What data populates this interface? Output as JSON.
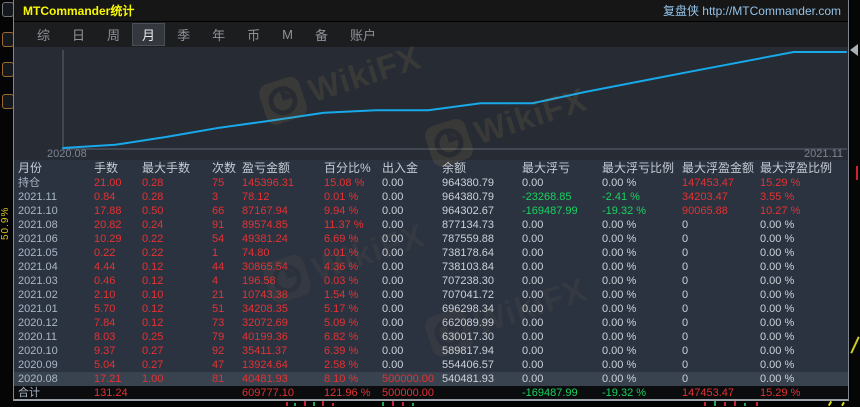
{
  "window": {
    "title": "MTCommander统计",
    "brand": "复盘侠 http://MTCommander.com"
  },
  "background": {
    "left_percent": "50.9%"
  },
  "menu": {
    "items": [
      {
        "label": "综",
        "selected": false
      },
      {
        "label": "日",
        "selected": false
      },
      {
        "label": "周",
        "selected": false
      },
      {
        "label": "月",
        "selected": true
      },
      {
        "label": "季",
        "selected": false
      },
      {
        "label": "年",
        "selected": false
      },
      {
        "label": "币",
        "selected": false
      },
      {
        "label": "M",
        "selected": false
      },
      {
        "label": "备",
        "selected": false
      },
      {
        "label": "账户",
        "selected": false
      }
    ]
  },
  "chart": {
    "x_start_label": "2020.08",
    "x_end_label": "2021.11",
    "watermark_text": "WikiFX"
  },
  "chart_data": {
    "type": "line",
    "title": "",
    "x": [
      "2020.08",
      "2020.09",
      "2020.10",
      "2020.11",
      "2020.12",
      "2021.01",
      "2021.02",
      "2021.03",
      "2021.04",
      "2021.05",
      "2021.06",
      "2021.08",
      "2021.10",
      "2021.11"
    ],
    "series": [
      {
        "name": "余额",
        "values": [
          540481.93,
          554406.57,
          589817.94,
          630017.3,
          662089.99,
          696298.34,
          707041.72,
          707238.3,
          738103.84,
          738178.64,
          787559.88,
          877134.73,
          964302.67,
          964380.79
        ]
      }
    ],
    "xlabel": "",
    "ylabel": "",
    "visible_tick_labels": [
      "2020.08",
      "2021.11"
    ],
    "line_color": "#17a9ea",
    "grid": false,
    "legend": false
  },
  "table": {
    "headers": [
      "月份",
      "手数",
      "最大手数",
      "次数",
      "盈亏金额",
      "百分比%",
      "出入金",
      "余额",
      "最大浮亏",
      "最大浮亏比例",
      "最大浮盈金额",
      "最大浮盈比例"
    ],
    "rows": [
      {
        "cells": [
          "持仓",
          "21.00",
          "0.28",
          "75",
          "145396.31",
          "15.08 %",
          "0.00",
          "964380.79",
          "0.00",
          "0.00 %",
          "147453.47",
          "15.29 %"
        ],
        "colors": [
          "m",
          "r",
          "r",
          "r",
          "r",
          "r",
          "w",
          "w",
          "w",
          "w",
          "r",
          "r"
        ]
      },
      {
        "cells": [
          "2021.11",
          "0.84",
          "0.28",
          "3",
          "78.12",
          "0.01 %",
          "0.00",
          "964380.79",
          "-23268.85",
          "-2.41 %",
          "34203.47",
          "3.55 %"
        ],
        "colors": [
          "m",
          "r",
          "r",
          "r",
          "r",
          "r",
          "w",
          "w",
          "g",
          "g",
          "r",
          "r"
        ]
      },
      {
        "cells": [
          "2021.10",
          "17.88",
          "0.50",
          "66",
          "87167.94",
          "9.94 %",
          "0.00",
          "964302.67",
          "-169487.99",
          "-19.32 %",
          "90065.88",
          "10.27 %"
        ],
        "colors": [
          "m",
          "r",
          "r",
          "r",
          "r",
          "r",
          "w",
          "w",
          "g",
          "g",
          "r",
          "r"
        ]
      },
      {
        "cells": [
          "2021.08",
          "20.82",
          "0.24",
          "91",
          "89574.85",
          "11.37 %",
          "0.00",
          "877134.73",
          "0.00",
          "0.00 %",
          "0",
          "0.00 %"
        ],
        "colors": [
          "m",
          "r",
          "r",
          "r",
          "r",
          "r",
          "w",
          "w",
          "w",
          "w",
          "w",
          "w"
        ]
      },
      {
        "cells": [
          "2021.06",
          "10.29",
          "0.22",
          "54",
          "49381.24",
          "6.69 %",
          "0.00",
          "787559.88",
          "0.00",
          "0.00 %",
          "0",
          "0.00 %"
        ],
        "colors": [
          "m",
          "r",
          "r",
          "r",
          "r",
          "r",
          "w",
          "w",
          "w",
          "w",
          "w",
          "w"
        ]
      },
      {
        "cells": [
          "2021.05",
          "0.22",
          "0.22",
          "1",
          "74.80",
          "0.01 %",
          "0.00",
          "738178.64",
          "0.00",
          "0.00 %",
          "0",
          "0.00 %"
        ],
        "colors": [
          "m",
          "r",
          "r",
          "r",
          "r",
          "r",
          "w",
          "w",
          "w",
          "w",
          "w",
          "w"
        ]
      },
      {
        "cells": [
          "2021.04",
          "4.44",
          "0.12",
          "44",
          "30865.54",
          "4.36 %",
          "0.00",
          "738103.84",
          "0.00",
          "0.00 %",
          "0",
          "0.00 %"
        ],
        "colors": [
          "m",
          "r",
          "r",
          "r",
          "r",
          "r",
          "w",
          "w",
          "w",
          "w",
          "w",
          "w"
        ]
      },
      {
        "cells": [
          "2021.03",
          "0.46",
          "0.12",
          "4",
          "196.58",
          "0.03 %",
          "0.00",
          "707238.30",
          "0.00",
          "0.00 %",
          "0",
          "0.00 %"
        ],
        "colors": [
          "m",
          "r",
          "r",
          "r",
          "r",
          "r",
          "w",
          "w",
          "w",
          "w",
          "w",
          "w"
        ]
      },
      {
        "cells": [
          "2021.02",
          "2.10",
          "0.10",
          "21",
          "10743.38",
          "1.54 %",
          "0.00",
          "707041.72",
          "0.00",
          "0.00 %",
          "0",
          "0.00 %"
        ],
        "colors": [
          "m",
          "r",
          "r",
          "r",
          "r",
          "r",
          "w",
          "w",
          "w",
          "w",
          "w",
          "w"
        ]
      },
      {
        "cells": [
          "2021.01",
          "5.70",
          "0.12",
          "51",
          "34208.35",
          "5.17 %",
          "0.00",
          "696298.34",
          "0.00",
          "0.00 %",
          "0",
          "0.00 %"
        ],
        "colors": [
          "m",
          "r",
          "r",
          "r",
          "r",
          "r",
          "w",
          "w",
          "w",
          "w",
          "w",
          "w"
        ]
      },
      {
        "cells": [
          "2020.12",
          "7.84",
          "0.12",
          "73",
          "32072.69",
          "5.09 %",
          "0.00",
          "662089.99",
          "0.00",
          "0.00 %",
          "0",
          "0.00 %"
        ],
        "colors": [
          "m",
          "r",
          "r",
          "r",
          "r",
          "r",
          "w",
          "w",
          "w",
          "w",
          "w",
          "w"
        ]
      },
      {
        "cells": [
          "2020.11",
          "8.03",
          "0.25",
          "79",
          "40199.36",
          "6.82 %",
          "0.00",
          "630017.30",
          "0.00",
          "0.00 %",
          "0",
          "0.00 %"
        ],
        "colors": [
          "m",
          "r",
          "r",
          "r",
          "r",
          "r",
          "w",
          "w",
          "w",
          "w",
          "w",
          "w"
        ]
      },
      {
        "cells": [
          "2020.10",
          "9.37",
          "0.27",
          "92",
          "35411.37",
          "6.39 %",
          "0.00",
          "589817.94",
          "0.00",
          "0.00 %",
          "0",
          "0.00 %"
        ],
        "colors": [
          "m",
          "r",
          "r",
          "r",
          "r",
          "r",
          "w",
          "w",
          "w",
          "w",
          "w",
          "w"
        ]
      },
      {
        "cells": [
          "2020.09",
          "5.04",
          "0.27",
          "47",
          "13924.64",
          "2.58 %",
          "0.00",
          "554406.57",
          "0.00",
          "0.00 %",
          "0",
          "0.00 %"
        ],
        "colors": [
          "m",
          "r",
          "r",
          "r",
          "r",
          "r",
          "w",
          "w",
          "w",
          "w",
          "w",
          "w"
        ]
      },
      {
        "cells": [
          "2020.08",
          "17.21",
          "1.00",
          "81",
          "40481.93",
          "8.10 %",
          "500000.00",
          "540481.93",
          "0.00",
          "0.00 %",
          "0",
          "0.00 %"
        ],
        "colors": [
          "m",
          "r",
          "r",
          "r",
          "r",
          "r",
          "r",
          "w",
          "w",
          "w",
          "w",
          "w"
        ],
        "highlight": true
      },
      {
        "cells": [
          "合计",
          "131.24",
          "",
          "",
          "609777.10",
          "121.96 %",
          "500000.00",
          "",
          "-169487.99",
          "-19.32 %",
          "147453.47",
          "15.29 %"
        ],
        "colors": [
          "m",
          "r",
          "",
          "",
          "r",
          "r",
          "r",
          "",
          "g",
          "g",
          "r",
          "r"
        ],
        "total": true
      }
    ]
  }
}
